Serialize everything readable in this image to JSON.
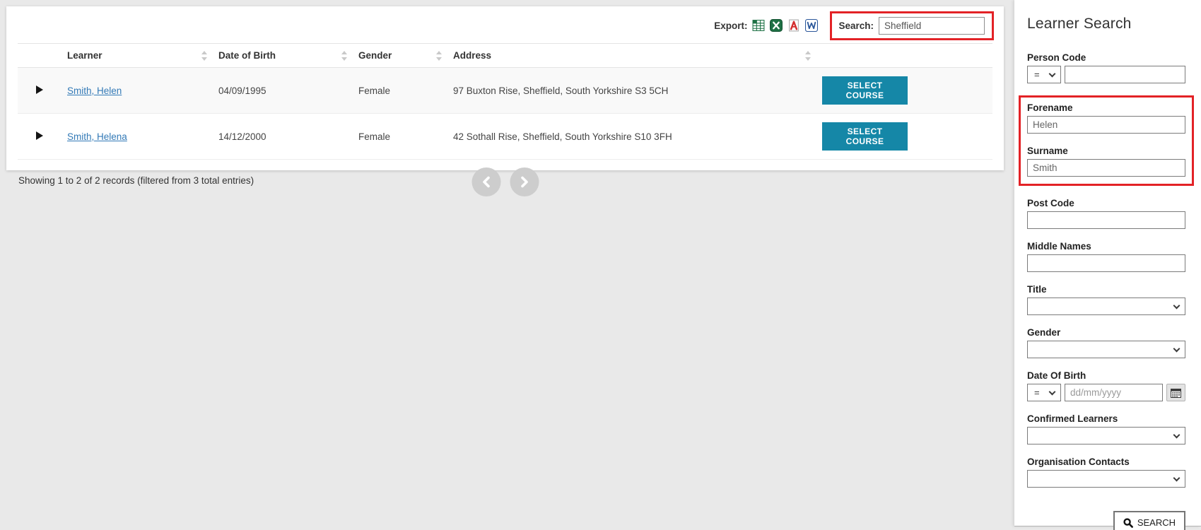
{
  "toolbar": {
    "export_label": "Export:",
    "export_icons": [
      "csv-export-icon",
      "excel-export-icon",
      "pdf-export-icon",
      "word-export-icon"
    ],
    "search_label": "Search:",
    "search_value": "Sheffield"
  },
  "table": {
    "columns": [
      "Learner",
      "Date of Birth",
      "Gender",
      "Address"
    ],
    "rows": [
      {
        "learner": "Smith, Helen",
        "dob": "04/09/1995",
        "gender": "Female",
        "address": "97 Buxton Rise, Sheffield, South Yorkshire S3 5CH",
        "action": "SELECT COURSE"
      },
      {
        "learner": "Smith, Helena",
        "dob": "14/12/2000",
        "gender": "Female",
        "address": "42 Sothall Rise, Sheffield, South Yorkshire S10 3FH",
        "action": "SELECT COURSE"
      }
    ],
    "summary": "Showing 1 to 2 of 2 records (filtered from 3 total entries)",
    "pagination_icons": [
      "chevron-left-icon",
      "chevron-right-icon"
    ]
  },
  "sidebar": {
    "title": "Learner Search",
    "person_code": {
      "label": "Person Code",
      "operator": "=",
      "value": ""
    },
    "forename": {
      "label": "Forename",
      "value": "Helen"
    },
    "surname": {
      "label": "Surname",
      "value": "Smith"
    },
    "post_code": {
      "label": "Post Code",
      "value": ""
    },
    "middle_names": {
      "label": "Middle Names",
      "value": ""
    },
    "title_field": {
      "label": "Title",
      "value": ""
    },
    "gender": {
      "label": "Gender",
      "value": ""
    },
    "date_of_birth": {
      "label": "Date Of Birth",
      "operator": "=",
      "placeholder": "dd/mm/yyyy",
      "value": ""
    },
    "confirmed_learners": {
      "label": "Confirmed Learners",
      "value": ""
    },
    "organisation_contacts": {
      "label": "Organisation Contacts",
      "value": ""
    },
    "search_button": "SEARCH"
  },
  "colors": {
    "accent": "#1587a7",
    "highlight_red": "#e32226",
    "link_blue": "#337ab7"
  }
}
